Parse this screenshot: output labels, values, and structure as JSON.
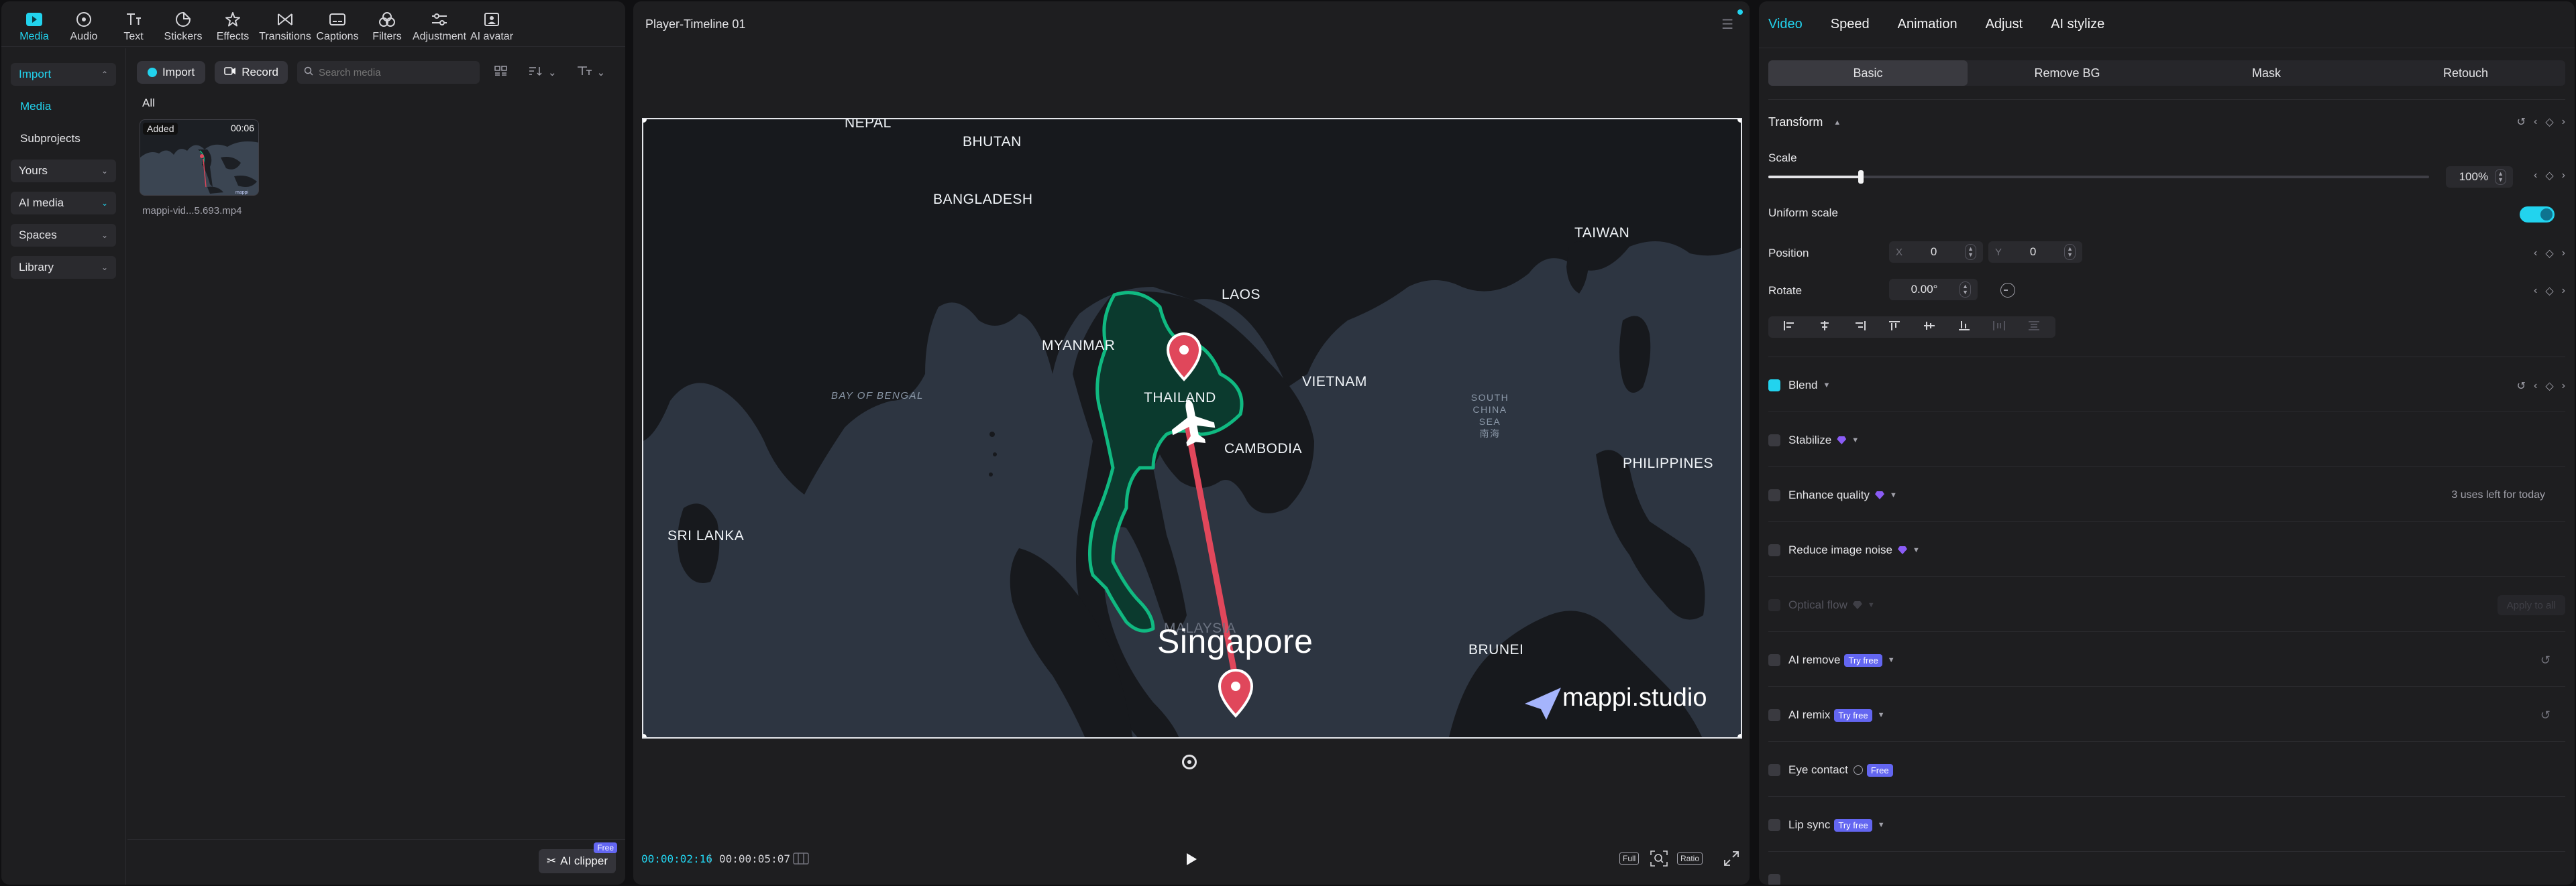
{
  "left_tabs": [
    {
      "label": "Media",
      "icon": "media-icon",
      "active": true
    },
    {
      "label": "Audio",
      "icon": "audio-icon"
    },
    {
      "label": "Text",
      "icon": "text-icon"
    },
    {
      "label": "Stickers",
      "icon": "stickers-icon"
    },
    {
      "label": "Effects",
      "icon": "effects-icon"
    },
    {
      "label": "Transitions",
      "icon": "transitions-icon"
    },
    {
      "label": "Captions",
      "icon": "captions-icon"
    },
    {
      "label": "Filters",
      "icon": "filters-icon"
    },
    {
      "label": "Adjustment",
      "icon": "adjustment-icon"
    },
    {
      "label": "AI avatar",
      "icon": "ai-avatar-icon"
    }
  ],
  "side_nav": {
    "import": "Import",
    "media": "Media",
    "subprojects": "Subprojects",
    "yours": "Yours",
    "ai_media": "AI media",
    "spaces": "Spaces",
    "library": "Library"
  },
  "media": {
    "import_btn": "Import",
    "record_btn": "Record",
    "search_placeholder": "Search media",
    "filter_label": "All",
    "item": {
      "badge": "Added",
      "duration": "00:06",
      "name": "mappi-vid...5.693.mp4"
    },
    "ai_clipper": "AI clipper",
    "free_tag": "Free"
  },
  "player": {
    "title": "Player-Timeline 01",
    "current_time": "00:00:02:16",
    "total_time": "00:00:05:07",
    "full_label": "Full",
    "ratio_label": "Ratio"
  },
  "map": {
    "labels": {
      "nepal": "NEPAL",
      "bhutan": "BHUTAN",
      "bangladesh": "BANGLADESH",
      "taiwan": "TAIWAN",
      "laos": "LAOS",
      "myanmar": "MYANMAR",
      "thailand": "THAILAND",
      "vietnam": "VIETNAM",
      "cambodia": "CAMBODIA",
      "bay_of_bengal": "BAY OF BENGAL",
      "south_china_sea": "SOUTH CHINA SEA",
      "south_china_sea_cn": "南海",
      "sri_lanka": "SRI LANKA",
      "philippines": "PHILIPPINES",
      "malaysia": "MALAYSIA",
      "singapore": "Singapore",
      "brunei": "BRUNEI"
    },
    "watermark": "mappi.studio",
    "accent": "#10b981",
    "route_color": "#e0475b"
  },
  "right": {
    "tabs": [
      "Video",
      "Speed",
      "Animation",
      "Adjust",
      "AI stylize"
    ],
    "subtabs": [
      "Basic",
      "Remove BG",
      "Mask",
      "Retouch"
    ],
    "transform": "Transform",
    "scale_label": "Scale",
    "scale_value": "100%",
    "scale_fraction": 0.14,
    "uniform_scale": "Uniform scale",
    "position_label": "Position",
    "pos_x_axis": "X",
    "pos_x": "0",
    "pos_y_axis": "Y",
    "pos_y": "0",
    "rotate_label": "Rotate",
    "rotate_value": "0.00°",
    "blend": "Blend",
    "stabilize": "Stabilize",
    "enhance_quality": "Enhance quality",
    "uses_left": "3 uses left for today",
    "reduce_noise": "Reduce image noise",
    "optical_flow": "Optical flow",
    "apply_all": "Apply to all",
    "ai_remove": "AI remove",
    "ai_remix": "AI remix",
    "try_free": "Try free",
    "eye_contact": "Eye contact",
    "free": "Free",
    "lip_sync": "Lip sync",
    "accent": "#22d3ee"
  }
}
